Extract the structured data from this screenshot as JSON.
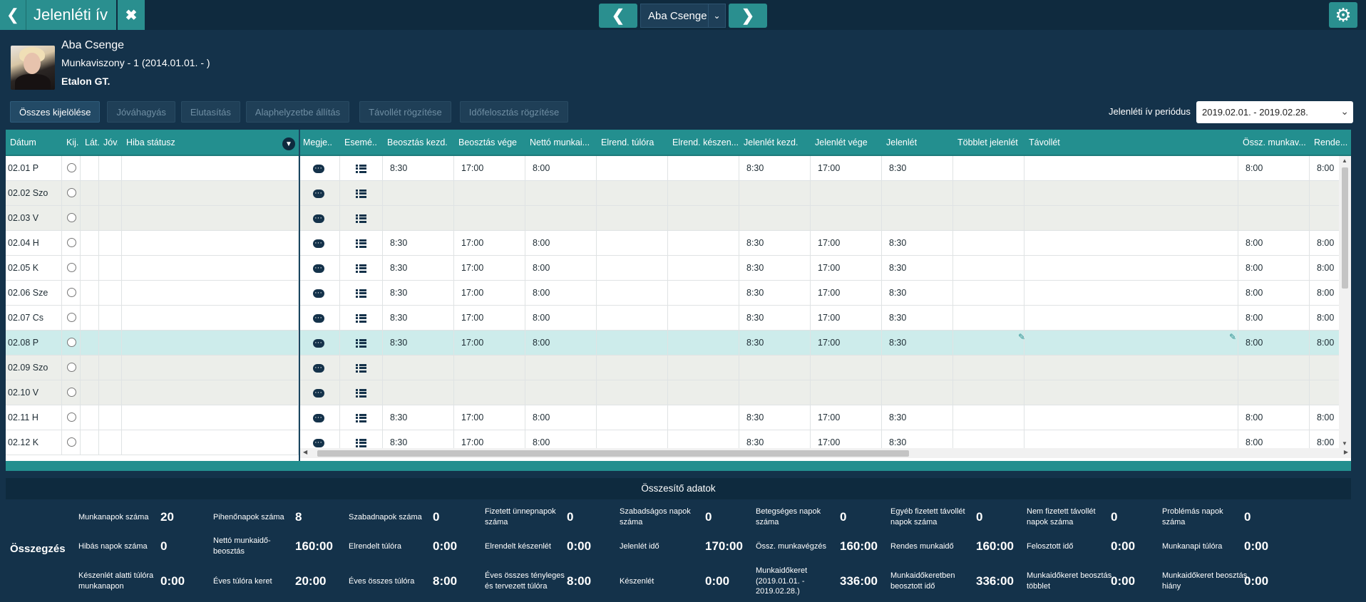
{
  "topbar": {
    "back_icon": "chevron-left-icon",
    "title": "Jelenléti ív",
    "close_icon": "close-icon",
    "prev_icon": "chevron-left-icon",
    "person": "Aba Csenge",
    "next_icon": "chevron-right-icon",
    "gear_icon": "gear-icon"
  },
  "profile": {
    "name": "Aba Csenge",
    "employment": "Munkaviszony - 1 (2014.01.01. - )",
    "company": "Etalon GT."
  },
  "toolbar": {
    "select_all": "Összes kijelölése",
    "approve": "Jóváhagyás",
    "reject": "Elutasítás",
    "reset": "Alaphelyzetbe állítás",
    "record_absence": "Távollét rögzítése",
    "record_time_allocation": "Időfelosztás rögzítése",
    "period_label": "Jelenléti ív periódus",
    "period_value": "2019.02.01. - 2019.02.28."
  },
  "grid": {
    "columns": [
      "Dátum",
      "Kij.",
      "Lát.",
      "Jóv.",
      "Hiba státusz",
      "Megje...",
      "Esemé...",
      "Beosztás kezd.",
      "Beosztás vége",
      "Nettó munkai...",
      "Elrend. túlóra",
      "Elrend. készen...",
      "Jelenlét kezd.",
      "Jelenlét vége",
      "Jelenlét",
      "Többlet jelenlét",
      "Távollét",
      "Össz. munkav...",
      "Rende..."
    ],
    "rows": [
      {
        "date": "02.01 P",
        "type": "normal",
        "bk": "8:30",
        "bv": "17:00",
        "net": "8:00",
        "jk": "8:30",
        "jv": "17:00",
        "j": "8:30",
        "ossz": "8:00",
        "rend": "8:00"
      },
      {
        "date": "02.02 Szo",
        "type": "weekend",
        "bk": "",
        "bv": "",
        "net": "",
        "jk": "",
        "jv": "",
        "j": "",
        "ossz": "",
        "rend": ""
      },
      {
        "date": "02.03 V",
        "type": "weekend",
        "bk": "",
        "bv": "",
        "net": "",
        "jk": "",
        "jv": "",
        "j": "",
        "ossz": "",
        "rend": ""
      },
      {
        "date": "02.04 H",
        "type": "normal",
        "bk": "8:30",
        "bv": "17:00",
        "net": "8:00",
        "jk": "8:30",
        "jv": "17:00",
        "j": "8:30",
        "ossz": "8:00",
        "rend": "8:00"
      },
      {
        "date": "02.05 K",
        "type": "normal",
        "bk": "8:30",
        "bv": "17:00",
        "net": "8:00",
        "jk": "8:30",
        "jv": "17:00",
        "j": "8:30",
        "ossz": "8:00",
        "rend": "8:00"
      },
      {
        "date": "02.06 Sze",
        "type": "normal",
        "bk": "8:30",
        "bv": "17:00",
        "net": "8:00",
        "jk": "8:30",
        "jv": "17:00",
        "j": "8:30",
        "ossz": "8:00",
        "rend": "8:00"
      },
      {
        "date": "02.07 Cs",
        "type": "normal",
        "bk": "8:30",
        "bv": "17:00",
        "net": "8:00",
        "jk": "8:30",
        "jv": "17:00",
        "j": "8:30",
        "ossz": "8:00",
        "rend": "8:00"
      },
      {
        "date": "02.08 P",
        "type": "selected",
        "bk": "8:30",
        "bv": "17:00",
        "net": "8:00",
        "jk": "8:30",
        "jv": "17:00",
        "j": "8:30",
        "ossz": "8:00",
        "rend": "8:00"
      },
      {
        "date": "02.09 Szo",
        "type": "weekend",
        "bk": "",
        "bv": "",
        "net": "",
        "jk": "",
        "jv": "",
        "j": "",
        "ossz": "",
        "rend": ""
      },
      {
        "date": "02.10 V",
        "type": "weekend",
        "bk": "",
        "bv": "",
        "net": "",
        "jk": "",
        "jv": "",
        "j": "",
        "ossz": "",
        "rend": ""
      },
      {
        "date": "02.11 H",
        "type": "normal",
        "bk": "8:30",
        "bv": "17:00",
        "net": "8:00",
        "jk": "8:30",
        "jv": "17:00",
        "j": "8:30",
        "ossz": "8:00",
        "rend": "8:00"
      },
      {
        "date": "02.12 K",
        "type": "normal",
        "bk": "8:30",
        "bv": "17:00",
        "net": "8:00",
        "jk": "8:30",
        "jv": "17:00",
        "j": "8:30",
        "ossz": "8:00",
        "rend": "8:00"
      }
    ]
  },
  "summary": {
    "header": "Összesítő adatok",
    "label": "Összegzés",
    "items": [
      [
        {
          "label": "Munkanapok száma",
          "value": "20"
        },
        {
          "label": "Pihenőnapok száma",
          "value": "8"
        },
        {
          "label": "Szabadnapok száma",
          "value": "0"
        },
        {
          "label": "Fizetett ünnepnapok száma",
          "value": "0"
        },
        {
          "label": "Szabadságos napok száma",
          "value": "0"
        },
        {
          "label": "Betegséges napok száma",
          "value": "0"
        },
        {
          "label": "Egyéb fizetett távollét napok száma",
          "value": "0"
        },
        {
          "label": "Nem fizetett távollét napok száma",
          "value": "0"
        },
        {
          "label": "Problémás napok száma",
          "value": "0"
        }
      ],
      [
        {
          "label": "Hibás napok száma",
          "value": "0"
        },
        {
          "label": "Nettó munkaidő-beosztás",
          "value": "160:00"
        },
        {
          "label": "Elrendelt túlóra",
          "value": "0:00"
        },
        {
          "label": "Elrendelt készenlét",
          "value": "0:00"
        },
        {
          "label": "Jelenlét idő",
          "value": "170:00"
        },
        {
          "label": "Össz. munkavégzés",
          "value": "160:00"
        },
        {
          "label": "Rendes munkaidő",
          "value": "160:00"
        },
        {
          "label": "Felosztott idő",
          "value": "0:00"
        },
        {
          "label": "Munkanapi túlóra",
          "value": "0:00"
        }
      ],
      [
        {
          "label": "Készenlét alatti túlóra munkanapon",
          "value": "0:00"
        },
        {
          "label": "Éves túlóra keret",
          "value": "20:00"
        },
        {
          "label": "Éves összes túlóra",
          "value": "8:00"
        },
        {
          "label": "Éves összes tényleges és tervezett túlóra",
          "value": "8:00"
        },
        {
          "label": "Készenlét",
          "value": "0:00"
        },
        {
          "label": "Munkaidőkeret (2019.01.01. - 2019.02.28.)",
          "value": "336:00"
        },
        {
          "label": "Munkaidőkeretben beosztott idő",
          "value": "336:00"
        },
        {
          "label": "Munkaidőkeret beosztás többlet",
          "value": "0:00"
        },
        {
          "label": "Munkaidőkeret beosztás hiány",
          "value": "0:00"
        }
      ]
    ]
  },
  "colors": {
    "background": "#14324a",
    "accent": "#2a8f8f",
    "header_bar": "#0f2a3e",
    "selected_row": "#cdeceb",
    "weekend_row": "#eceeea"
  }
}
